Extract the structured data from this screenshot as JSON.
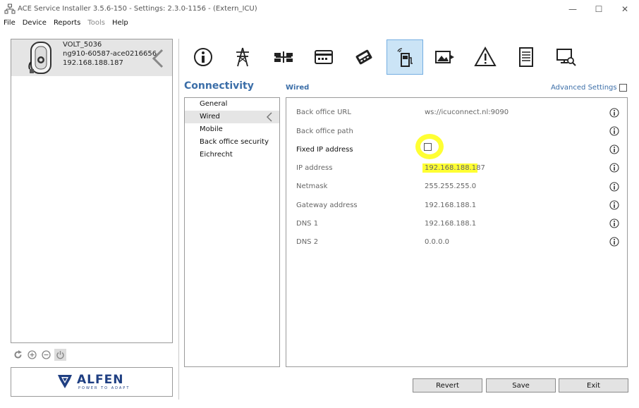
{
  "window": {
    "title": "ACE Service Installer 3.5.6-150 - Settings: 2.3.0-1156 -  (Extern_ICU)",
    "minimize": "—",
    "maximize": "☐",
    "close": "✕"
  },
  "menu": [
    "File",
    "Device",
    "Reports",
    "Tools",
    "Help"
  ],
  "device": {
    "name": "VOLT_5036",
    "serial": "ng910-60587-ace0216656",
    "ip": "192.168.188.187"
  },
  "brand": {
    "logo": "ALFEN",
    "tagline": "POWER TO ADAPT"
  },
  "section": {
    "title": "Connectivity",
    "subsection": "Wired",
    "advanced_settings_label": "Advanced Settings"
  },
  "submenu": [
    "General",
    "Wired",
    "Mobile",
    "Back office security",
    "Eichrecht"
  ],
  "settings": {
    "back_office_url": {
      "label": "Back office URL",
      "value": "ws://icuconnect.nl:9090"
    },
    "back_office_path": {
      "label": "Back office path",
      "value": ""
    },
    "fixed_ip": {
      "label": "Fixed IP address"
    },
    "ip_address": {
      "label": "IP address",
      "value": "192.168.188.187"
    },
    "netmask": {
      "label": "Netmask",
      "value": "255.255.255.0"
    },
    "gateway": {
      "label": "Gateway address",
      "value": "192.168.188.1"
    },
    "dns1": {
      "label": "DNS 1",
      "value": "192.168.188.1"
    },
    "dns2": {
      "label": "DNS 2",
      "value": "0.0.0.0"
    }
  },
  "buttons": {
    "revert": "Revert",
    "save": "Save",
    "exit": "Exit"
  },
  "colors": {
    "accent": "#3b6ea8",
    "highlight": "#ffff33",
    "selected_tab": "#cbe4f6",
    "brand": "#1f3f82"
  }
}
